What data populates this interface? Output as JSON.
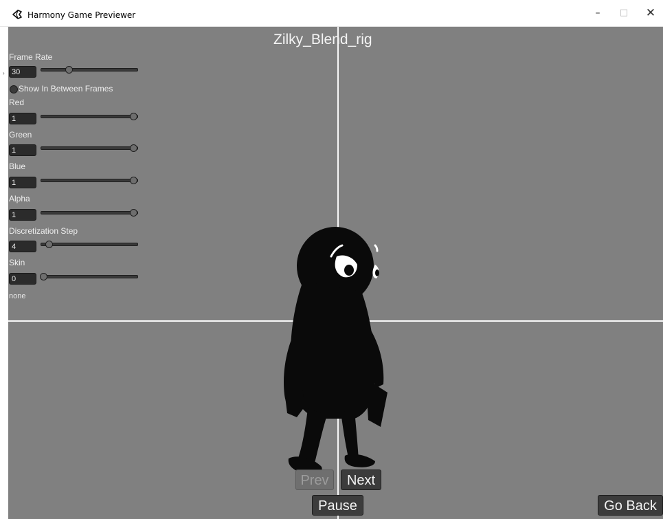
{
  "window": {
    "title": "Harmony Game Previewer",
    "minimize_glyph": "–",
    "maximize_glyph": "□",
    "close_glyph": "✕"
  },
  "viewport": {
    "rig_name": "Zilky_Blend_rig",
    "background_color": "#808080",
    "axis_color": "#ffffff"
  },
  "controls": {
    "frame_rate": {
      "label": "Frame Rate",
      "value": "30",
      "slider_fraction": 0.28
    },
    "show_in_between": {
      "label": "Show In Between Frames"
    },
    "red": {
      "label": "Red",
      "value": "1",
      "slider_fraction": 1.0
    },
    "green": {
      "label": "Green",
      "value": "1",
      "slider_fraction": 1.0
    },
    "blue": {
      "label": "Blue",
      "value": "1",
      "slider_fraction": 1.0
    },
    "alpha": {
      "label": "Alpha",
      "value": "1",
      "slider_fraction": 1.0
    },
    "discretization_step": {
      "label": "Discretization Step",
      "value": "4",
      "slider_fraction": 0.06
    },
    "skin": {
      "label": "Skin",
      "value": "0",
      "slider_fraction": 0.0,
      "name": "none"
    }
  },
  "buttons": {
    "prev": "Prev",
    "next": "Next",
    "pause": "Pause",
    "go_back": "Go Back"
  }
}
